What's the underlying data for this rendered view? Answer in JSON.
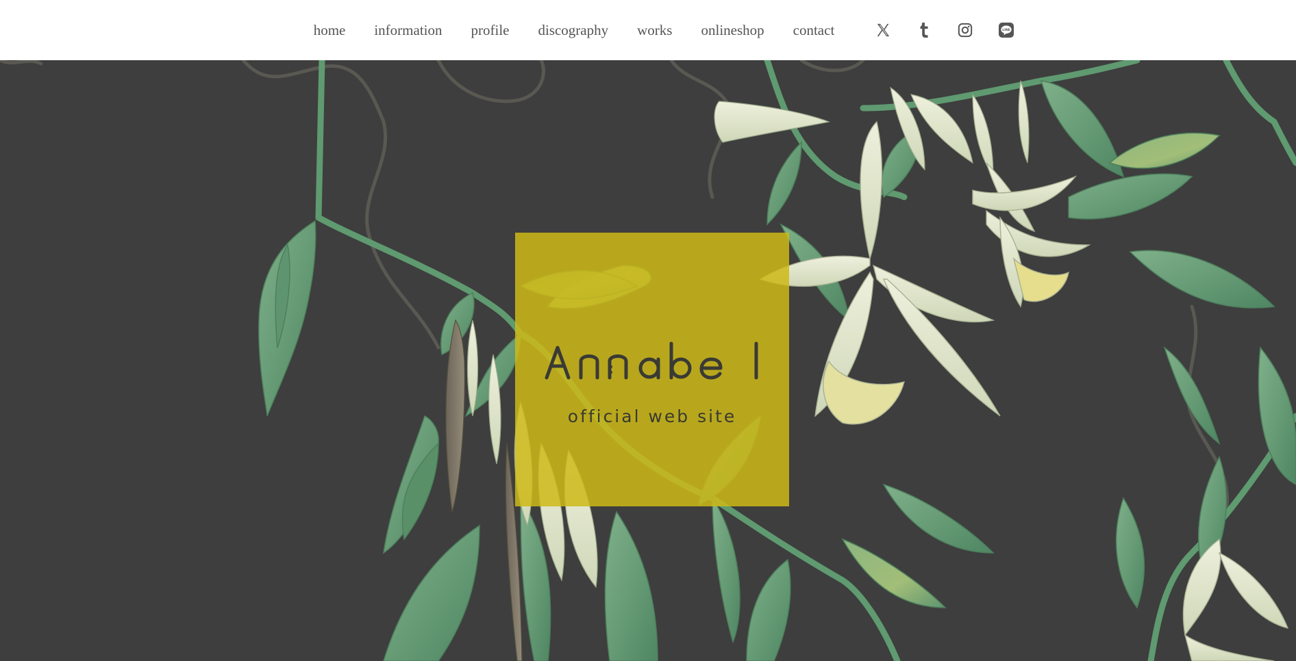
{
  "nav": {
    "links": [
      {
        "label": "home"
      },
      {
        "label": "information"
      },
      {
        "label": "profile"
      },
      {
        "label": "discography"
      },
      {
        "label": "works"
      },
      {
        "label": "onlineshop"
      },
      {
        "label": "contact"
      }
    ],
    "social": [
      {
        "icon": "x-icon"
      },
      {
        "icon": "tumblr-icon"
      },
      {
        "icon": "instagram-icon"
      },
      {
        "icon": "line-icon"
      }
    ]
  },
  "hero": {
    "logo_text": "Annabel",
    "tagline": "official web site",
    "colors": {
      "background": "#3e3e3e",
      "logo_box": "#c9b424",
      "leaf": "#6a9f78",
      "flower": "#e6ead0",
      "vine": "#5a5a52"
    }
  }
}
